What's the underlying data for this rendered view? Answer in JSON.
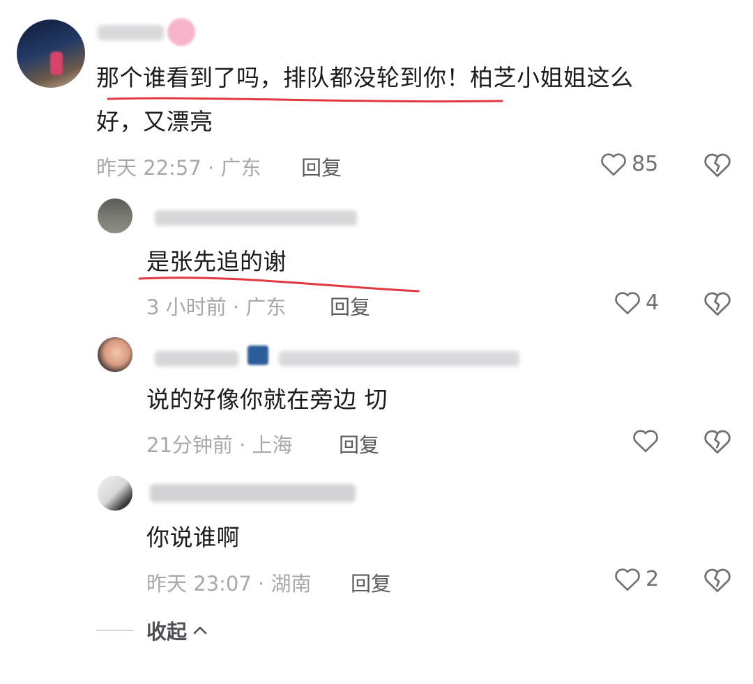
{
  "colors": {
    "underline": "#e0383e",
    "meta": "#a7a8ad",
    "text": "#1b1b1f"
  },
  "comments": [
    {
      "text_line1": "那个谁看到了吗，排队都没轮到你！柏芝小姐姐这么",
      "text_line2": "好，又漂亮",
      "meta": "昨天 22:57 · 广东",
      "reply": "回复",
      "likes": "85"
    },
    {
      "text": "是张先追的谢",
      "meta": "3 小时前 · 广东",
      "reply": "回复",
      "likes": "4"
    },
    {
      "text": "说的好像你就在旁边 切",
      "meta": "21分钟前 · 上海",
      "reply": "回复",
      "likes": ""
    },
    {
      "text": "你说谁啊",
      "meta": "昨天 23:07 · 湖南",
      "reply": "回复",
      "likes": "2"
    }
  ],
  "collapse": {
    "label": "收起"
  },
  "icons": {
    "like": "heart-outline-icon",
    "dislike": "broken-heart-icon",
    "collapse": "chevron-up-icon"
  }
}
